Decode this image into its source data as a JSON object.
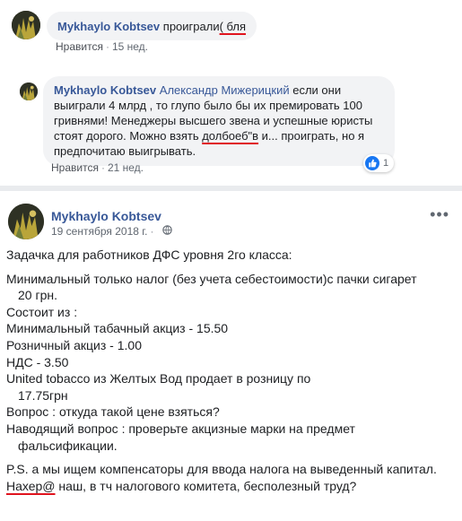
{
  "comments": [
    {
      "author": "Mykhaylo Kobtsev",
      "text_before": "проиграли",
      "text_underlined": "( бля",
      "like_label": "Нравится",
      "time": "15 нед."
    },
    {
      "author": "Mykhaylo Kobtsev",
      "mention": "Александр Мижерицкий",
      "text_1": " если они выиграли 4 млрд , то глупо было бы их премировать 100 гривнями! Менеджеры высшего звена и успешные юристы стоят дорого. Можно взять ",
      "text_underlined": "долбоеб\"в",
      "text_2": " и... проиграть, но я предпочитаю выигрывать.",
      "like_label": "Нравится",
      "time": "21 нед.",
      "reaction_count": "1"
    }
  ],
  "post": {
    "author": "Mykhaylo Kobtsev",
    "date": "19 сентября 2018 г.",
    "more": "•••",
    "lines": [
      "Задачка для работников ДФС уровня 2го класса:",
      "Минимальный только налог (без учета себестоимости)с пачки сигарет",
      "20 грн.",
      "Состоит из :",
      "Минимальный табачный акциз - 15.50",
      "Розничный акциз - 1.00",
      "НДС - 3.50",
      "United tobacco из Желтых Вод продает в розницу по",
      "17.75грн",
      "Вопрос : откуда такой цене взяться?",
      "Наводящий вопрос : проверьте акцизные марки на предмет",
      "фальсификации.",
      "P.S. а мы ищем компенсаторы для ввода налога на выведенный капитал."
    ],
    "last_underlined": "Нахер@",
    "last_rest": " наш, в тч налогового комитета, бесполезный труд?"
  }
}
